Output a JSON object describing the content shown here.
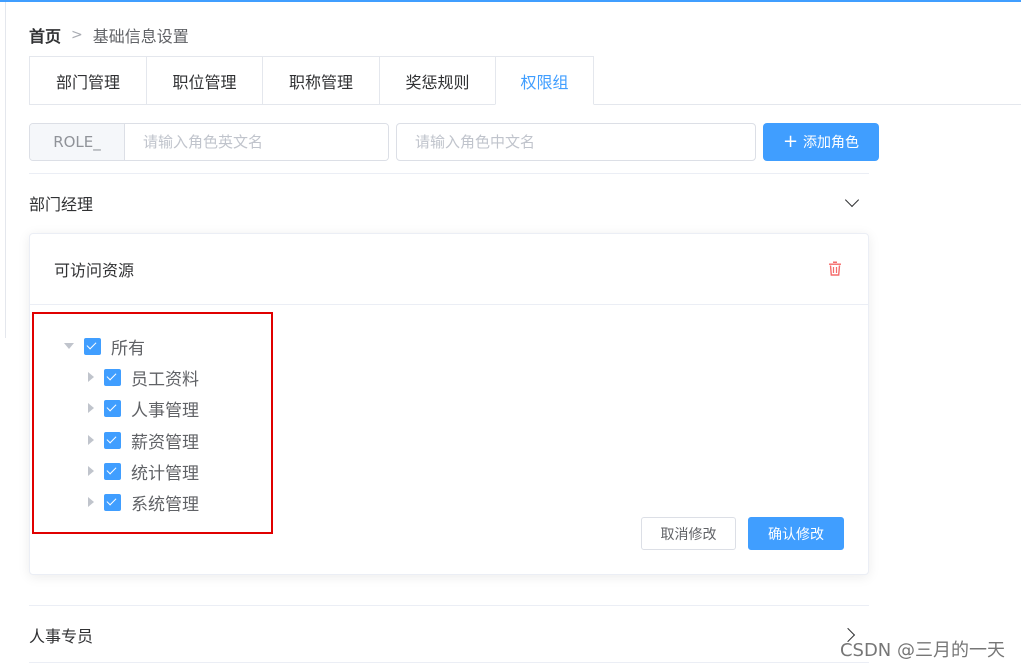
{
  "breadcrumb": {
    "home": "首页",
    "separator": ">",
    "current": "基础信息设置"
  },
  "tabs": [
    {
      "label": "部门管理"
    },
    {
      "label": "职位管理"
    },
    {
      "label": "职称管理"
    },
    {
      "label": "奖惩规则"
    },
    {
      "label": "权限组",
      "active": true
    }
  ],
  "role_form": {
    "prefix": "ROLE_",
    "en_placeholder": "请输入角色英文名",
    "cn_placeholder": "请输入角色中文名",
    "add_label": "添加角色",
    "add_icon": "+"
  },
  "roles": [
    {
      "name": "部门经理",
      "expanded": true
    },
    {
      "name": "人事专员",
      "expanded": false
    }
  ],
  "card": {
    "title": "可访问资源",
    "tree": {
      "root": {
        "label": "所有",
        "checked": true,
        "expanded": true
      },
      "children": [
        {
          "label": "员工资料",
          "checked": true
        },
        {
          "label": "人事管理",
          "checked": true
        },
        {
          "label": "薪资管理",
          "checked": true
        },
        {
          "label": "统计管理",
          "checked": true
        },
        {
          "label": "系统管理",
          "checked": true
        }
      ]
    },
    "cancel_label": "取消修改",
    "confirm_label": "确认修改"
  },
  "watermark": "CSDN @三月的一天",
  "colors": {
    "primary": "#409eff",
    "danger": "#f56c6c",
    "highlight_box": "#e00000"
  }
}
